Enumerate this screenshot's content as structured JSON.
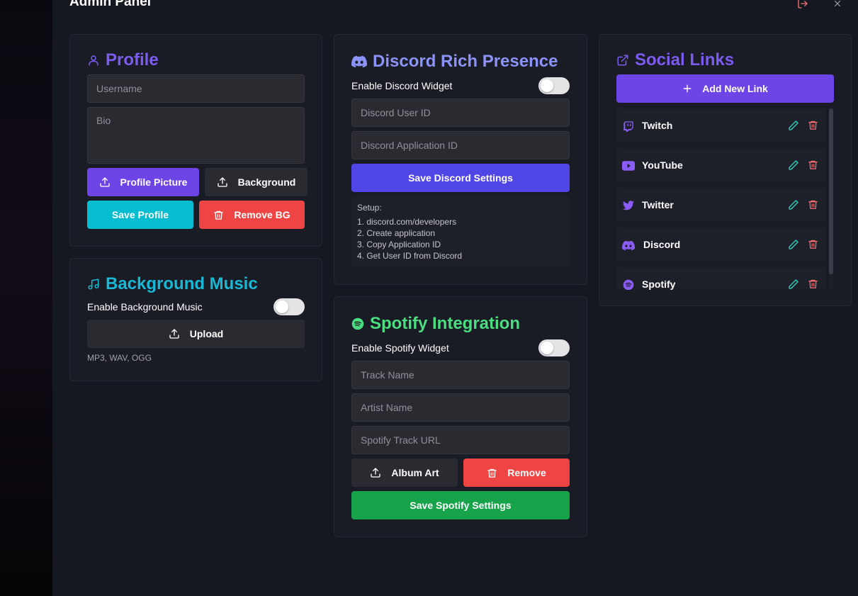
{
  "panel": {
    "title": "Admin Panel"
  },
  "profile": {
    "title": "Profile",
    "username_placeholder": "Username",
    "bio_placeholder": "Bio",
    "profile_picture_label": "Profile Picture",
    "background_label": "Background",
    "save_label": "Save Profile",
    "remove_bg_label": "Remove BG"
  },
  "music": {
    "title": "Background Music",
    "enable_label": "Enable Background Music",
    "upload_label": "Upload",
    "formats": "MP3, WAV, OGG"
  },
  "discord": {
    "title": "Discord Rich Presence",
    "enable_label": "Enable Discord Widget",
    "user_id_placeholder": "Discord User ID",
    "app_id_placeholder": "Discord Application ID",
    "save_label": "Save Discord Settings",
    "setup": {
      "title": "Setup:",
      "steps": [
        "1. discord.com/developers",
        "2. Create application",
        "3. Copy Application ID",
        "4. Get User ID from Discord"
      ]
    }
  },
  "spotify": {
    "title": "Spotify Integration",
    "enable_label": "Enable Spotify Widget",
    "track_placeholder": "Track Name",
    "artist_placeholder": "Artist Name",
    "url_placeholder": "Spotify Track URL",
    "album_art_label": "Album Art",
    "remove_label": "Remove",
    "save_label": "Save Spotify Settings"
  },
  "social": {
    "title": "Social Links",
    "add_label": "Add New Link",
    "links": [
      {
        "name": "Twitch",
        "icon": "twitch-icon"
      },
      {
        "name": "YouTube",
        "icon": "youtube-icon"
      },
      {
        "name": "Twitter",
        "icon": "twitter-icon"
      },
      {
        "name": "Discord",
        "icon": "discord-icon"
      },
      {
        "name": "Spotify",
        "icon": "spotify-icon"
      }
    ]
  },
  "colors": {
    "purple": "#6d45e6",
    "profile_title": "#7c5cf0",
    "cyan": "#06bcd1",
    "cyan_title": "#18b8d6",
    "red": "#ef4444",
    "discord_blue": "#5045e5",
    "discord_title": "#8b93f8",
    "green": "#16a34a",
    "green_title": "#4ade80"
  }
}
